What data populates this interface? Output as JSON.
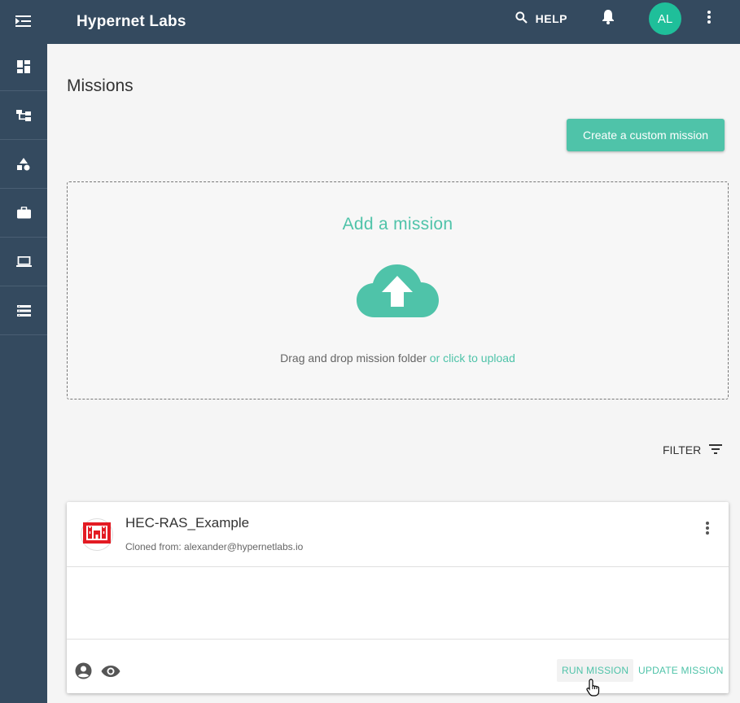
{
  "header": {
    "brand": "Hypernet Labs",
    "help_label": "HELP",
    "avatar_initials": "AL"
  },
  "sidebar": {
    "items": [
      {
        "icon": "dashboard-icon"
      },
      {
        "icon": "hierarchy-icon"
      },
      {
        "icon": "shapes-icon"
      },
      {
        "icon": "briefcase-icon"
      },
      {
        "icon": "laptop-icon"
      },
      {
        "icon": "list-icon"
      }
    ]
  },
  "main": {
    "title": "Missions",
    "create_button": "Create a custom mission",
    "dropzone": {
      "title": "Add a mission",
      "text": "Drag and drop mission folder",
      "link": "or click to upload"
    },
    "filter_label": "FILTER"
  },
  "mission_card": {
    "title": "HEC-RAS_Example",
    "subtitle": "Cloned from: alexander@hypernetlabs.io",
    "run_label": "RUN MISSION",
    "update_label": "UPDATE MISSION"
  },
  "colors": {
    "nav_bg": "#344a5f",
    "accent": "#4fc3a9",
    "avatar": "#1fbf9a"
  }
}
